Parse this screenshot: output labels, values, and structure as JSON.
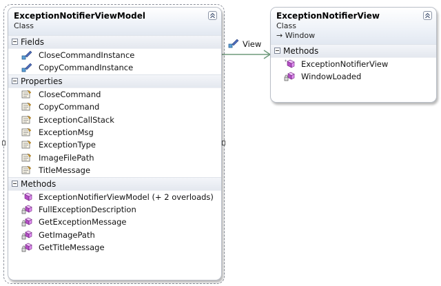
{
  "vm_class": {
    "title": "ExceptionNotifierViewModel",
    "kind": "Class",
    "collapse_glyph": "⌃",
    "sections": {
      "fields": {
        "label": "Fields",
        "items": [
          "CloseCommandInstance",
          "CopyCommandInstance"
        ]
      },
      "properties": {
        "label": "Properties",
        "items": [
          "CloseCommand",
          "CopyCommand",
          "ExceptionCallStack",
          "ExceptionMsg",
          "ExceptionType",
          "ImageFilePath",
          "TitleMessage"
        ]
      },
      "methods": {
        "label": "Methods",
        "items": [
          "ExceptionNotifierViewModel (+ 2 overloads)",
          "FullExceptionDescription",
          "GetExceptionMessage",
          "GetImagePath",
          "GetTitleMessage"
        ]
      }
    }
  },
  "view_class": {
    "title": "ExceptionNotifierView",
    "kind": "Class",
    "base": "→ Window",
    "collapse_glyph": "⌃",
    "sections": {
      "methods": {
        "label": "Methods",
        "items": [
          "ExceptionNotifierView",
          "WindowLoaded"
        ]
      }
    }
  },
  "association": {
    "label": "View",
    "icon": "field-icon"
  },
  "colors": {
    "connector": "#6f9a7b",
    "header_bg": "#e2e8f1",
    "border": "#b9bec7"
  }
}
